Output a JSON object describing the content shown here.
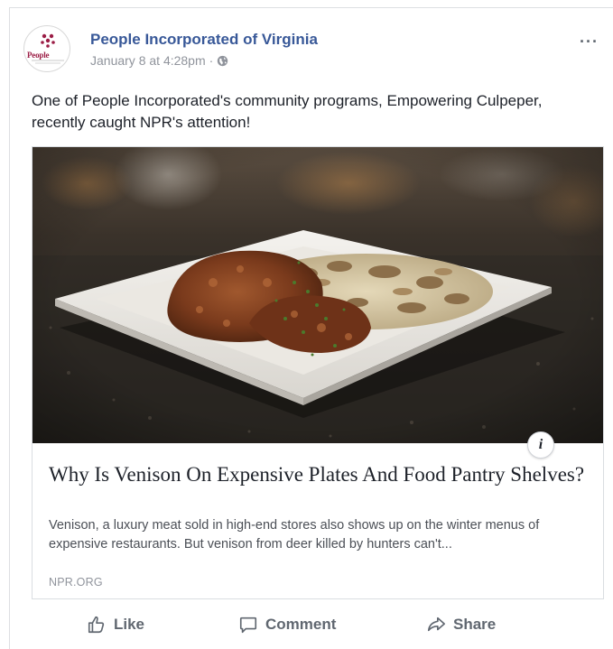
{
  "post": {
    "author": "People Incorporated of Virginia",
    "logo_text": "People",
    "timestamp": "January 8 at 4:28pm",
    "separator": "·",
    "more_label": "···",
    "text": "One of People Incorporated's community programs, Empowering Culpeper, recently caught NPR's attention!"
  },
  "link_preview": {
    "info_label": "i",
    "title": "Why Is Venison On Expensive Plates And Food Pantry Shelves?",
    "description": "Venison, a luxury meat sold in high-end stores also shows up on the winter menus of expensive restaurants. But venison from deer killed by hunters can't...",
    "domain": "NPR.ORG"
  },
  "actions": {
    "like": "Like",
    "comment": "Comment",
    "share": "Share"
  },
  "colors": {
    "author_link": "#385898",
    "meta_text": "#90949c",
    "action_text": "#606770",
    "border": "#dddfe2"
  },
  "icons": [
    "people-inc-logo-icon",
    "globe-icon",
    "more-icon",
    "info-icon",
    "like-icon",
    "comment-icon",
    "share-icon"
  ]
}
